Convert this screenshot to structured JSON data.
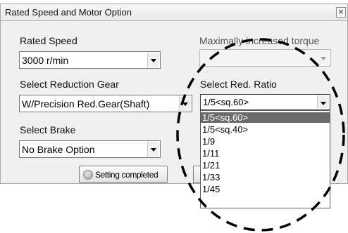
{
  "dialog": {
    "title": "Rated Speed and Motor Option",
    "close_glyph": "×"
  },
  "rated_speed": {
    "label": "Rated Speed",
    "value": "3000 r/min"
  },
  "max_torque": {
    "label": "Maximally increased torque",
    "value": ""
  },
  "reduction_gear": {
    "label": "Select Reduction Gear",
    "value": "W/Precision Red.Gear(Shaft)"
  },
  "red_ratio": {
    "label": "Select Red. Ratio",
    "value": "1/5<sq.60>",
    "options": [
      "1/5<sq.60>",
      "1/5<sq.40>",
      "1/9",
      "1/11",
      "1/21",
      "1/33",
      "1/45"
    ],
    "selected_index": 0
  },
  "brake": {
    "label": "Select Brake",
    "value": "No Brake Option"
  },
  "buttons": {
    "setting_completed": "Setting completed"
  },
  "colors": {
    "selected_item_bg": "#6b6b6b",
    "annotation_stroke": "#000000"
  },
  "icons": {
    "close": "close-icon",
    "dropdown_arrow": "chevron-down-icon",
    "status": "status-dot-icon"
  }
}
